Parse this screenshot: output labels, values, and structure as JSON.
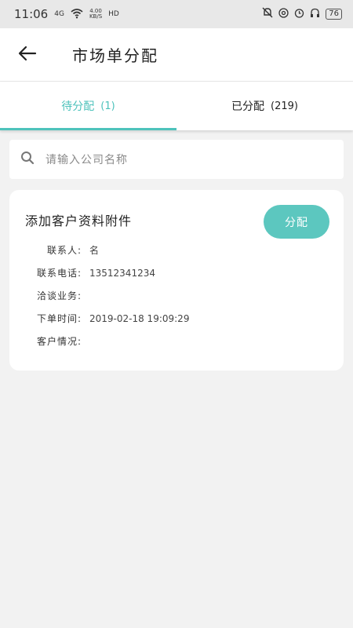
{
  "status_bar": {
    "time": "11:06",
    "signal": "4G",
    "speed_top": "4.00",
    "speed_bottom": "KB/S",
    "hd": "HD",
    "battery": "76"
  },
  "header": {
    "title": "市场单分配"
  },
  "tabs": [
    {
      "label": "待分配",
      "count": "(1)"
    },
    {
      "label": "已分配",
      "count": "(219)"
    }
  ],
  "search": {
    "placeholder": "请输入公司名称"
  },
  "card": {
    "title": "添加客户资料附件",
    "button_label": "分配",
    "rows": [
      {
        "label": "联系人:",
        "value": "名"
      },
      {
        "label": "联系电话:",
        "value": "13512341234"
      },
      {
        "label": "洽谈业务:",
        "value": ""
      },
      {
        "label": "下单时间:",
        "value": "2019-02-18 19:09:29"
      },
      {
        "label": "客户情况:",
        "value": ""
      }
    ]
  },
  "colors": {
    "accent": "#4dc2bb",
    "button": "#5cc7bf",
    "background": "#f2f2f2"
  }
}
